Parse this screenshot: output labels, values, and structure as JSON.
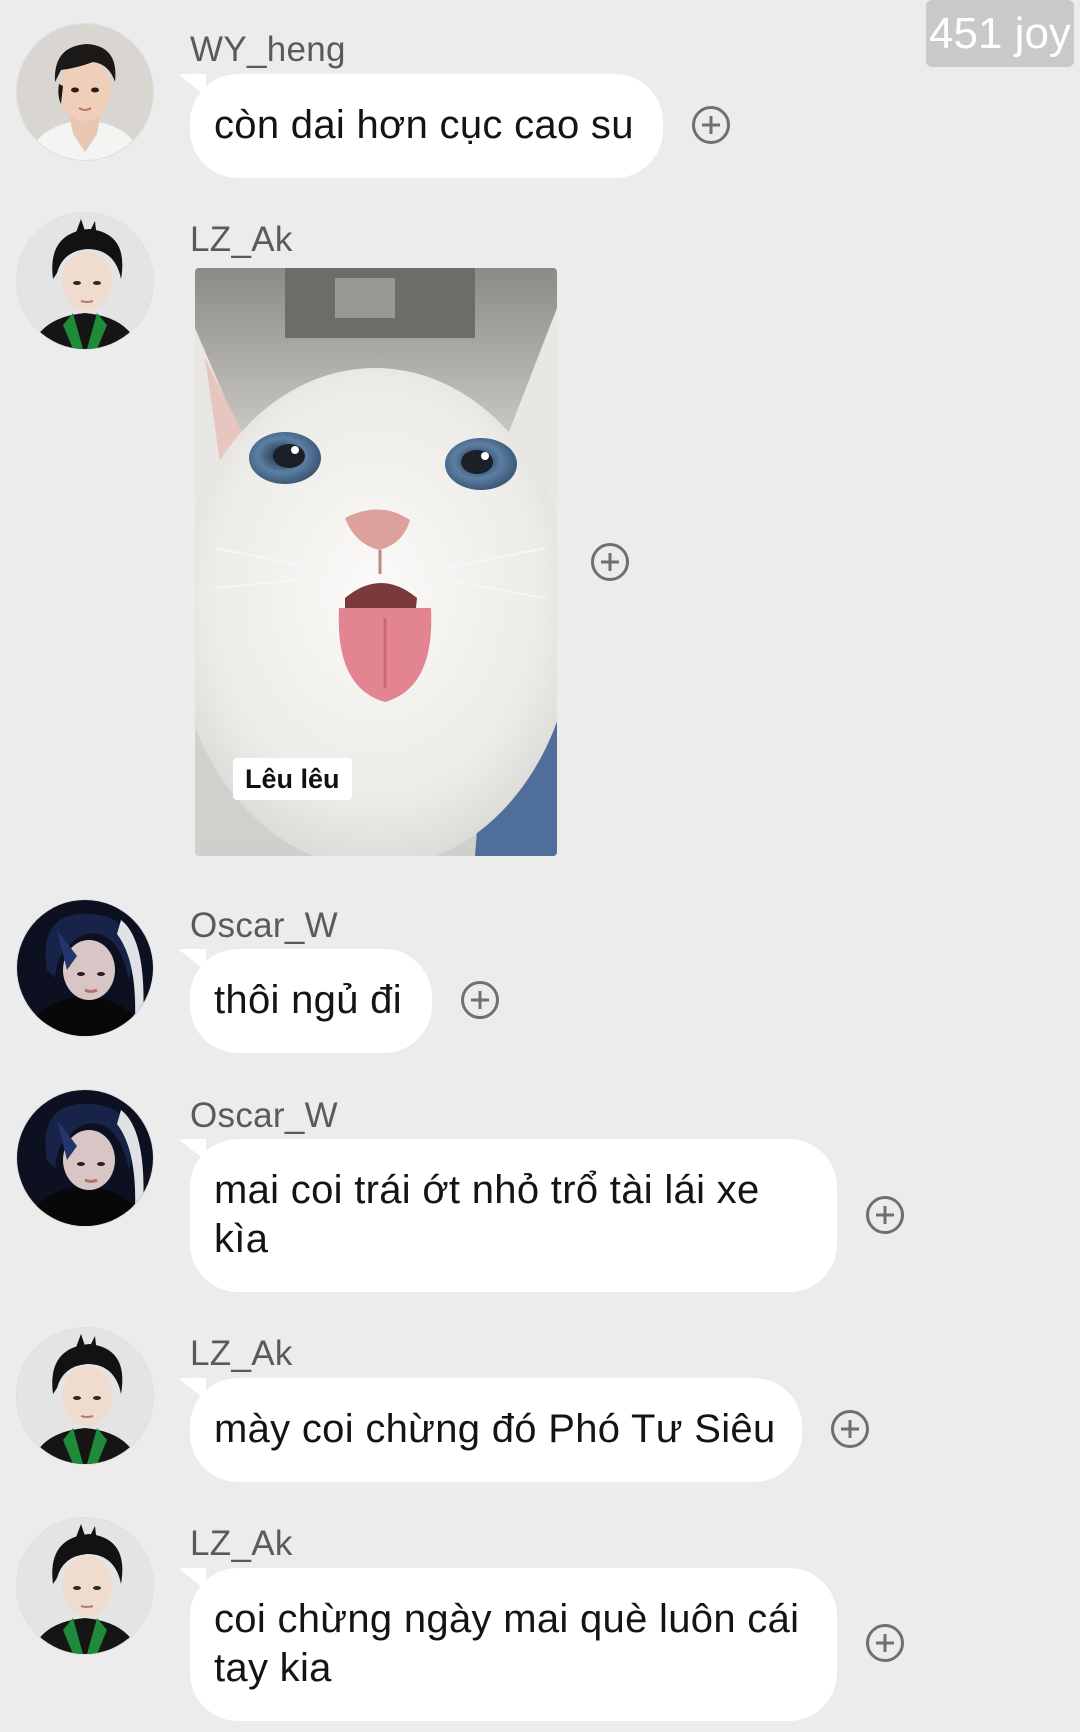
{
  "header": {
    "badge_text": "451 joy"
  },
  "messages": [
    {
      "sender": "WY_heng",
      "text": "còn dai hơn cục cao su",
      "avatar": "wy-heng-avatar"
    },
    {
      "sender": "LZ_Ak",
      "type": "sticker",
      "sticker_caption": "Lêu lêu",
      "sticker_description": "white cat sticking out its tongue",
      "avatar": "lz-ak-avatar"
    },
    {
      "sender": "Oscar_W",
      "text": "thôi ngủ đi",
      "avatar": "oscar-w-avatar"
    },
    {
      "sender": "Oscar_W",
      "text": "mai coi trái ớt nhỏ trổ tài lái xe kìa",
      "avatar": "oscar-w-avatar"
    },
    {
      "sender": "LZ_Ak",
      "text": "mày coi chừng đó Phó Tư Siêu",
      "avatar": "lz-ak-avatar"
    },
    {
      "sender": "LZ_Ak",
      "text": "coi chừng ngày mai què luôn cái tay kia",
      "avatar": "lz-ak-avatar"
    }
  ],
  "icons": {
    "react": "plus-circle-icon"
  },
  "colors": {
    "background": "#ececec",
    "bubble": "#ffffff",
    "text": "#141414",
    "username": "#5a5a5a",
    "badge": "#c9c9c9"
  }
}
